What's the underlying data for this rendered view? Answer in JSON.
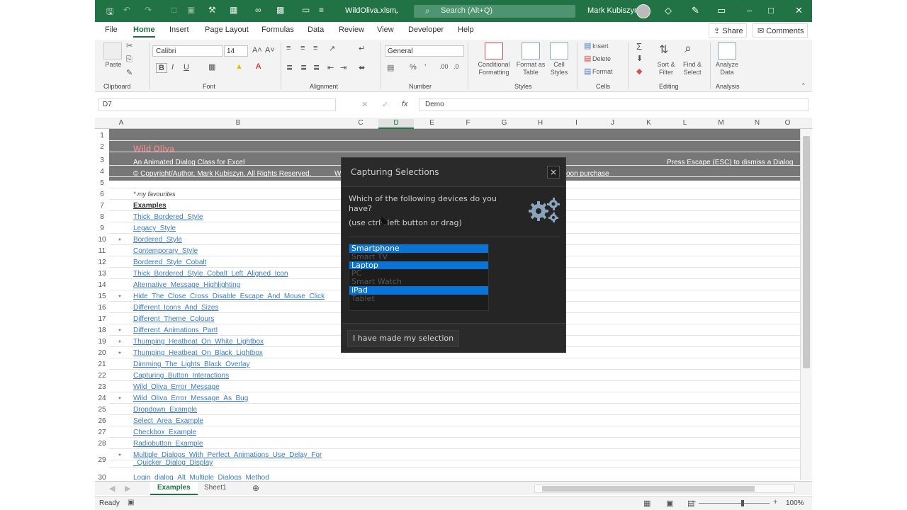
{
  "titlebar": {
    "filename": "WildOliva.xlsm",
    "search_placeholder": "Search (Alt+Q)",
    "user": "Mark Kubiszyn",
    "search_icon": "search-icon"
  },
  "menu": {
    "tabs": [
      "File",
      "Home",
      "Insert",
      "Page Layout",
      "Formulas",
      "Data",
      "Review",
      "View",
      "Developer",
      "Help"
    ],
    "active": "Home",
    "share": "Share",
    "comments": "Comments"
  },
  "ribbon": {
    "groups": [
      "Clipboard",
      "Font",
      "Alignment",
      "Number",
      "Styles",
      "Cells",
      "Editing",
      "Analysis"
    ],
    "paste": "Paste",
    "font_name": "Calibri",
    "font_size": "14",
    "number_format": "General",
    "conditional_formatting": "Conditional Formatting",
    "format_as_table": "Format as Table",
    "cell_styles": "Cell Styles",
    "insert": "Insert",
    "delete": "Delete",
    "format": "Format",
    "sort_filter": "Sort & Filter",
    "find_select": "Find & Select",
    "analyze_data": "Analyze Data"
  },
  "formula": {
    "name_box": "D7",
    "fx": "fx",
    "value": "Demo"
  },
  "columns": [
    "A",
    "B",
    "C",
    "D",
    "E",
    "F",
    "G",
    "H",
    "I",
    "J",
    "K",
    "L",
    "M",
    "N",
    "O"
  ],
  "selected_column": "D",
  "banner": {
    "title": "Wild Oliva",
    "subtitle": "An Animated Dialog Class for Excel",
    "copyright": "© Copyright/Author, Mark Kubiszyn. All Rights Reserved.",
    "copyright_tail": "oon purchase",
    "copyright_w": "W",
    "escape_hint": "Press Escape (ESC) to dismiss a Dialog"
  },
  "rows": [
    {
      "n": "1",
      "text": "",
      "star": "",
      "link": false
    },
    {
      "n": "2",
      "text": "",
      "star": "",
      "link": false
    },
    {
      "n": "3",
      "text": "",
      "star": "",
      "link": false
    },
    {
      "n": "4",
      "text": "",
      "star": "",
      "link": false
    },
    {
      "n": "5",
      "text": "",
      "star": "",
      "link": false
    },
    {
      "n": "6",
      "text": "* my favourites",
      "star": "",
      "link": false
    },
    {
      "n": "7",
      "text": "Examples",
      "star": "",
      "link": false
    },
    {
      "n": "8",
      "text": "Thick_Bordered_Style",
      "star": "",
      "link": true
    },
    {
      "n": "9",
      "text": "Legacy_Style",
      "star": "",
      "link": true
    },
    {
      "n": "10",
      "text": "Bordered_Style",
      "star": "*",
      "link": true
    },
    {
      "n": "11",
      "text": "Contemporary_Style",
      "star": "",
      "link": true
    },
    {
      "n": "12",
      "text": "Bordered_Style_Cobalt",
      "star": "",
      "link": true
    },
    {
      "n": "13",
      "text": "Thick_Bordered_Style_Cobalt_Left_Aligned_Icon",
      "star": "",
      "link": true
    },
    {
      "n": "14",
      "text": "Alternative_Message_Highlighting",
      "star": "",
      "link": true
    },
    {
      "n": "15",
      "text": "Hide_The_Close_Cross_Disable_Escape_And_Mouse_Click",
      "star": "*",
      "link": true
    },
    {
      "n": "16",
      "text": "Different_Icons_And_Sizes",
      "star": "",
      "link": true
    },
    {
      "n": "17",
      "text": "Different_Theme_Colours",
      "star": "",
      "link": true
    },
    {
      "n": "18",
      "text": "Different_Animations_PartI",
      "star": "*",
      "link": true
    },
    {
      "n": "19",
      "text": "Thumping_Heatbeat_On_White_Lightbox",
      "star": "*",
      "link": true
    },
    {
      "n": "20",
      "text": "Thumping_Heatbeat_On_Black_Lightbox",
      "star": "*",
      "link": true
    },
    {
      "n": "21",
      "text": "Dimming_The_Lights_Black_Overlay",
      "star": "",
      "link": true
    },
    {
      "n": "22",
      "text": "Capturing_Button_Interactions",
      "star": "",
      "link": true
    },
    {
      "n": "23",
      "text": "Wild_Oliva_Error_Message",
      "star": "",
      "link": true
    },
    {
      "n": "24",
      "text": "Wild_Oliva_Error_Message_As_Bug",
      "star": "*",
      "link": true
    },
    {
      "n": "25",
      "text": "Dropdown_Example",
      "star": "",
      "link": true
    },
    {
      "n": "26",
      "text": "Select_Area_Example",
      "star": "",
      "link": true
    },
    {
      "n": "27",
      "text": "Checkbox_Example",
      "star": "",
      "link": true
    },
    {
      "n": "28",
      "text": "Radiobutton_Example",
      "star": "",
      "link": true
    },
    {
      "n": "29",
      "text": "Multiple_Dialogs_With_Perfect_Animations_Use_Delay_For",
      "star": "*",
      "link": true
    },
    {
      "n": "",
      "text": "_Quicker_Dialog_Display",
      "star": "",
      "link": true
    },
    {
      "n": "30",
      "text": "Login_dialog_Alt_Multiple_Dialogs_Method",
      "star": "",
      "link": true
    }
  ],
  "sheets": [
    "Examples",
    "Sheet1"
  ],
  "active_sheet": "Examples",
  "status": {
    "ready": "Ready",
    "zoom": "100%"
  },
  "dialog": {
    "title": "Capturing Selections",
    "close": "×",
    "question": "Which of the following  devices  do you have?",
    "hint": "(use ctrl+left button or drag)",
    "items": [
      {
        "label": "Smartphone",
        "selected": true
      },
      {
        "label": "Smart TV",
        "selected": false
      },
      {
        "label": "Laptop",
        "selected": true
      },
      {
        "label": "PC",
        "selected": false
      },
      {
        "label": "Smart Watch",
        "selected": false
      },
      {
        "label": "iPad",
        "selected": true
      },
      {
        "label": "Tablet",
        "selected": false
      }
    ],
    "confirm": "I have made my selection"
  },
  "colors": {
    "excel_green": "#217346",
    "link": "#3b7cc0",
    "selection": "#0a74d6",
    "banner": "#777777",
    "title_red": "#e08585"
  }
}
